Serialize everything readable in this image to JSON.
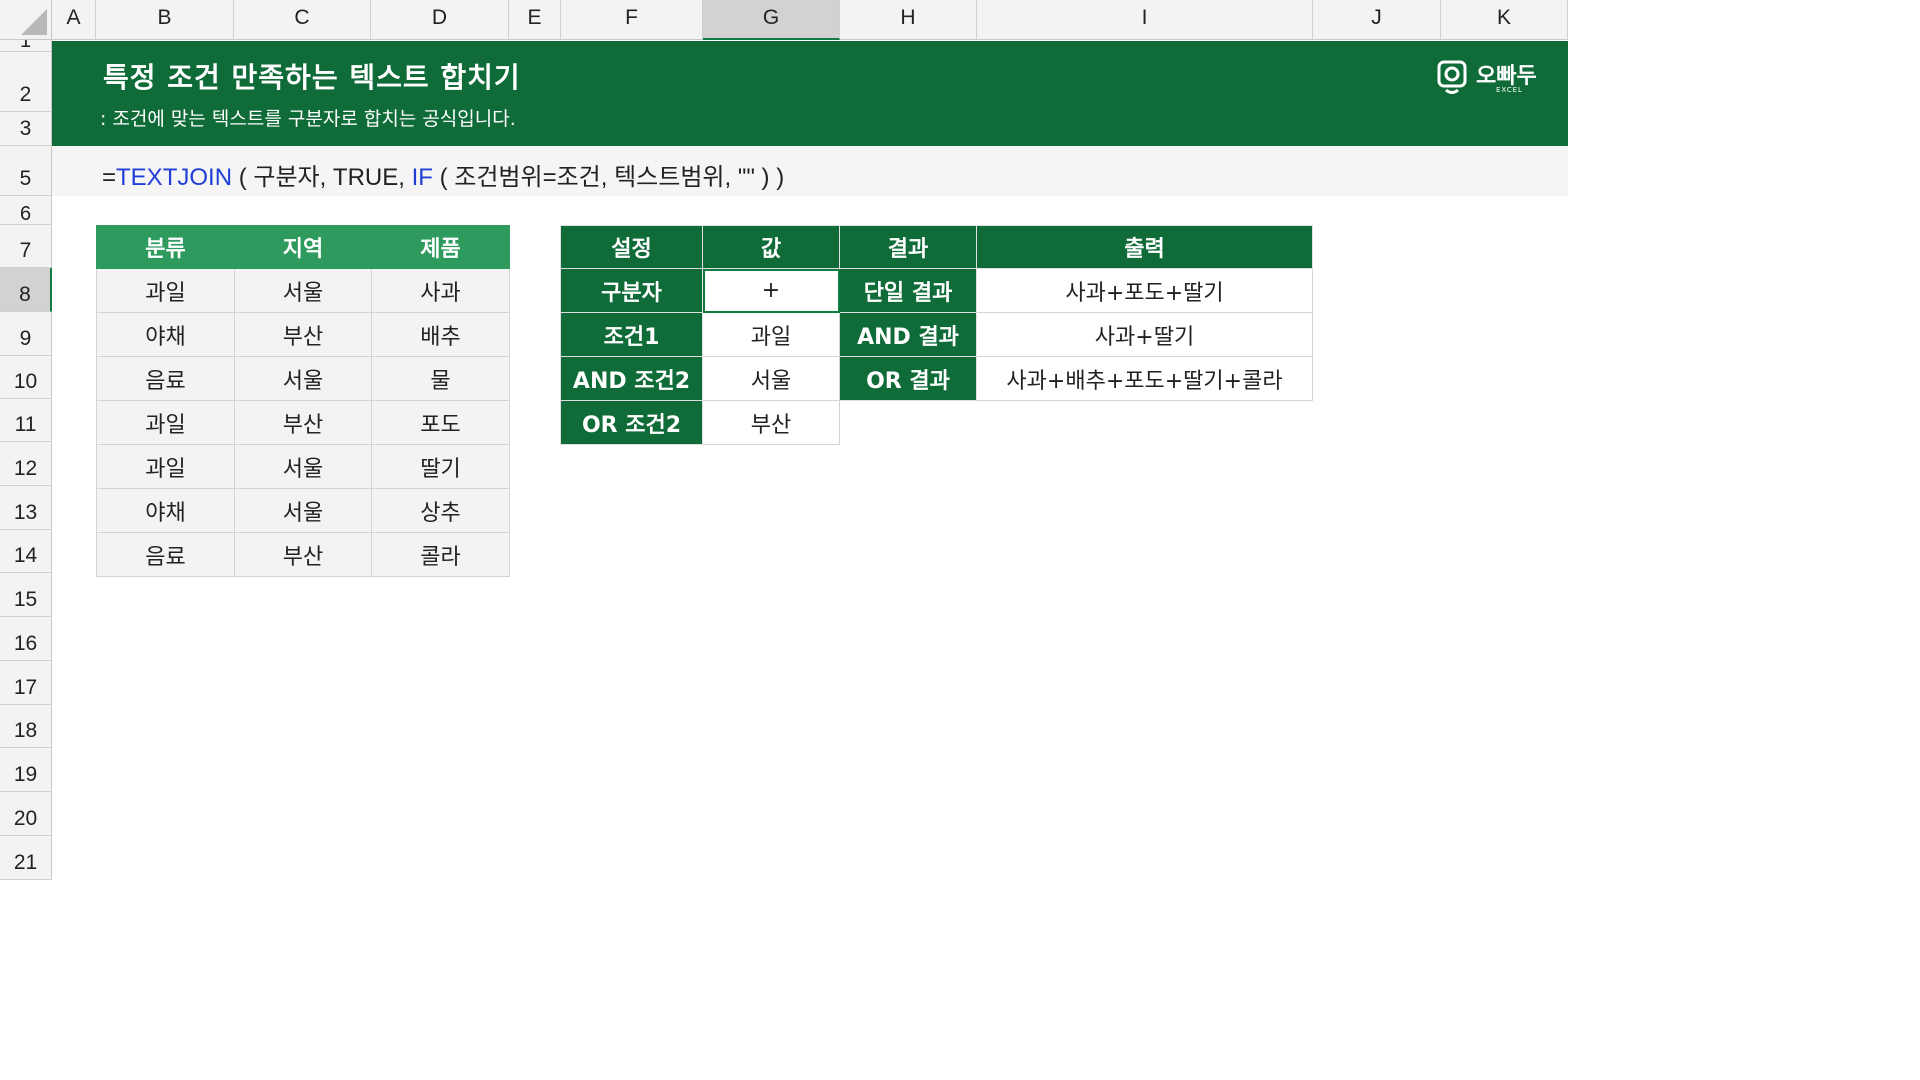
{
  "columns": [
    "A",
    "B",
    "C",
    "D",
    "E",
    "F",
    "G",
    "H",
    "I",
    "J",
    "K"
  ],
  "rows": [
    "1",
    "2",
    "3",
    "5",
    "6",
    "7",
    "8",
    "9",
    "10",
    "11",
    "12",
    "13",
    "14",
    "15",
    "16",
    "17",
    "18",
    "19",
    "20",
    "21"
  ],
  "selected_column": "G",
  "selected_row": "8",
  "banner": {
    "title": "특정 조건 만족하는 텍스트 합치기",
    "subtitle": ": 조건에 맞는 텍스트를 구분자로 합치는 공식입니다.",
    "logo_text": "오빠두",
    "logo_sub": "EXCEL"
  },
  "formula": {
    "eq": "=",
    "fn1": "TEXTJOIN",
    "part1": " ( 구분자, TRUE, ",
    "fn2": "IF",
    "part2": " ( 조건범위=조건, 텍스트범위, \"\" ) )"
  },
  "left_table": {
    "headers": [
      "분류",
      "지역",
      "제품"
    ],
    "rows": [
      [
        "과일",
        "서울",
        "사과"
      ],
      [
        "야채",
        "부산",
        "배추"
      ],
      [
        "음료",
        "서울",
        "물"
      ],
      [
        "과일",
        "부산",
        "포도"
      ],
      [
        "과일",
        "서울",
        "딸기"
      ],
      [
        "야채",
        "서울",
        "상추"
      ],
      [
        "음료",
        "부산",
        "콜라"
      ]
    ]
  },
  "right_table": {
    "headers": [
      "설정",
      "값",
      "결과",
      "출력"
    ],
    "rows": [
      [
        "구분자",
        "+",
        "단일 결과",
        "사과+포도+딸기"
      ],
      [
        "조건1",
        "과일",
        "AND 결과",
        "사과+딸기"
      ],
      [
        "AND 조건2",
        "서울",
        "OR 결과",
        "사과+배추+포도+딸기+콜라"
      ],
      [
        "OR 조건2",
        "부산",
        "",
        ""
      ]
    ]
  },
  "colors": {
    "banner": "#0f6b38",
    "left_header": "#2e9a5e",
    "formula_fn": "#1f3fd6"
  }
}
